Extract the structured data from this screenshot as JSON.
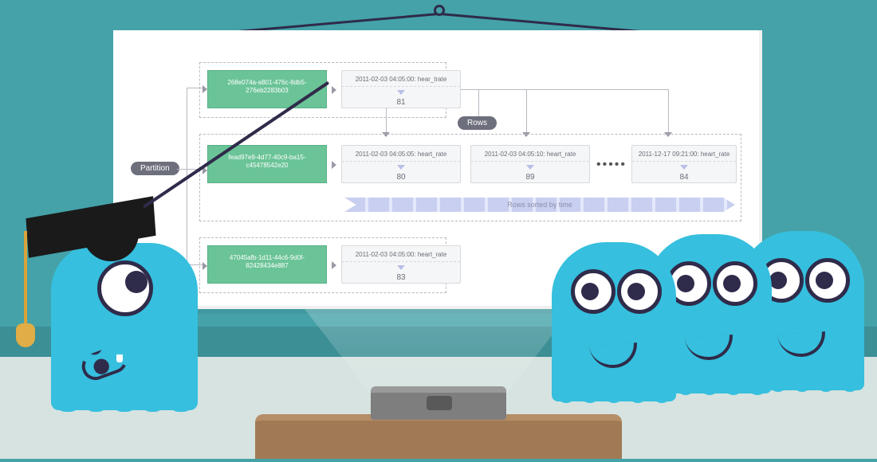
{
  "labels": {
    "partition": "Partition",
    "rows": "Rows",
    "sorted": "Rows sorted by time"
  },
  "rows": [
    {
      "partition_key": "268e074a-a801-476c-8db5-276eb2283b03",
      "cells": [
        {
          "header": "2011-02-03 04:05:00: hear_trate",
          "value": "81"
        }
      ]
    },
    {
      "partition_key": "fead97e9-4d77-40c9-ba15-c45478542e20",
      "cells": [
        {
          "header": "2011-02-03 04:05:05: heart_rate",
          "value": "80"
        },
        {
          "header": "2011-02-03 04:05:10: heart_rate",
          "value": "89"
        },
        {
          "header": "2011-12-17 09:21:00: heart_rate",
          "value": "84"
        }
      ]
    },
    {
      "partition_key": "47045afb-1d11-44c6-9d0f-82428434e887",
      "cells": [
        {
          "header": "2011-02-03 04:05:00: heart_rate",
          "value": "83"
        }
      ]
    }
  ]
}
